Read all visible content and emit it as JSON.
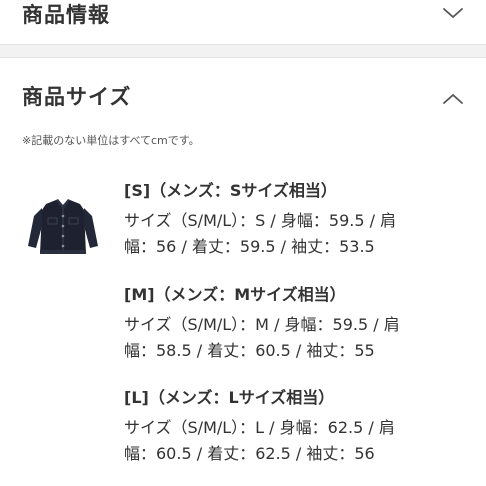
{
  "sections": {
    "product_info": {
      "title": "商品情報",
      "icon": "chevron-down-icon"
    },
    "product_size": {
      "title": "商品サイズ",
      "icon": "chevron-up-icon"
    }
  },
  "note": "※記載のない単位はすべてcmです。",
  "product_image": {
    "icon": "jacket-icon",
    "color": "#1e2230"
  },
  "sizes": [
    {
      "title": "[S]（メンズ：Sサイズ相当）",
      "line1": "サイズ（S/M/L）：S / 身幅：59.5 / 肩",
      "line2": "幅：56 / 着丈：59.5 / 袖丈：53.5"
    },
    {
      "title": "[M]（メンズ：Mサイズ相当）",
      "line1": "サイズ（S/M/L）：M / 身幅：59.5 / 肩",
      "line2": "幅：58.5 / 着丈：60.5 / 袖丈：55"
    },
    {
      "title": "[L]（メンズ：Lサイズ相当）",
      "line1": "サイズ（S/M/L）：L / 身幅：62.5 / 肩",
      "line2": "幅：60.5 / 着丈：62.5 / 袖丈：56"
    }
  ]
}
